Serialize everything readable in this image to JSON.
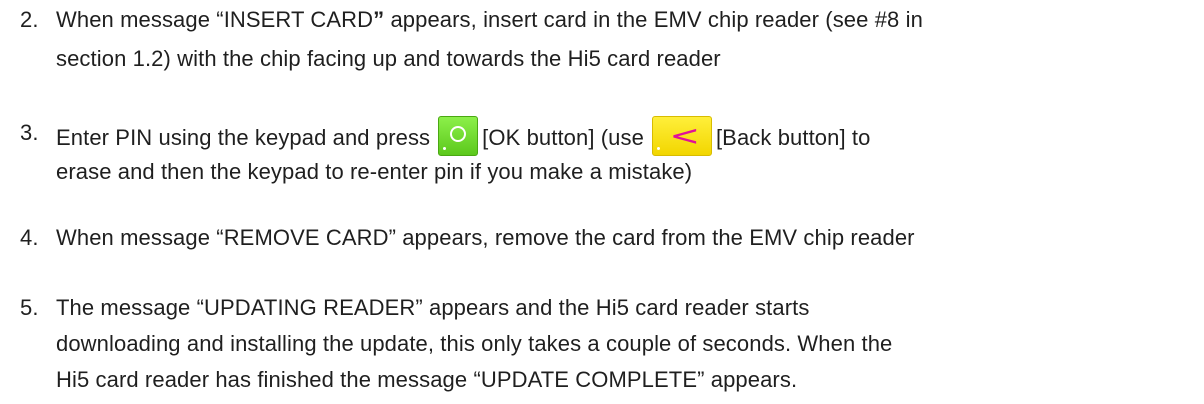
{
  "steps": [
    {
      "number": "2.",
      "lines": [
        {
          "parts": [
            "When message “INSERT CARD",
            "”",
            " appears, insert card in the EMV chip reader (see #8 in"
          ]
        },
        "section 1.2)  with the chip facing up and towards the Hi5 card reader"
      ]
    },
    {
      "number": "3.",
      "line1_a": "Enter PIN using the keypad and press",
      "ok_icon": "ok-button-icon",
      "line1_b": "[OK button] (use",
      "back_icon": "back-button-icon",
      "line1_c": "[Back button] to",
      "line2": "erase and then the keypad to re-enter pin if you make a mistake)"
    },
    {
      "number": "4.",
      "line1": "When message “REMOVE CARD” appears, remove the card from the EMV chip reader"
    },
    {
      "number": "5.",
      "lines": [
        "The message “UPDATING READER” appears and the Hi5 card reader starts",
        "downloading and installing the update, this only takes a couple of seconds. When the",
        "Hi5 card reader has finished the message “UPDATE COMPLETE” appears."
      ]
    }
  ],
  "colors": {
    "text": "#1f1f1f",
    "ok_button": "#6fdc2a",
    "back_button": "#fbe31a",
    "back_chevron": "#e0109a"
  }
}
